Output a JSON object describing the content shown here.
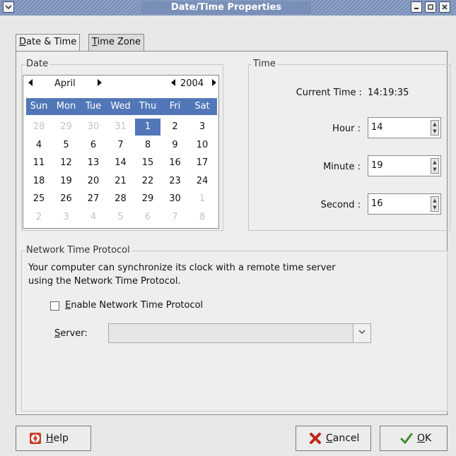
{
  "window": {
    "title": "Date/Time Properties",
    "menu_icon": "chevron-down-icon",
    "controls": [
      "minimize",
      "maximize",
      "close"
    ]
  },
  "tabs": [
    {
      "label_rest": "ate & Time",
      "accel": "D",
      "active": true
    },
    {
      "label_rest": "ime Zone",
      "accel": "T",
      "active": false
    }
  ],
  "date": {
    "frame_label": "Date",
    "month": "April",
    "year": "2004",
    "weekdays": [
      "Sun",
      "Mon",
      "Tue",
      "Wed",
      "Thu",
      "Fri",
      "Sat"
    ],
    "weeks": [
      [
        "28",
        "29",
        "30",
        "31",
        "1",
        "2",
        "3"
      ],
      [
        "4",
        "5",
        "6",
        "7",
        "8",
        "9",
        "10"
      ],
      [
        "11",
        "12",
        "13",
        "14",
        "15",
        "16",
        "17"
      ],
      [
        "18",
        "19",
        "20",
        "21",
        "22",
        "23",
        "24"
      ],
      [
        "25",
        "26",
        "27",
        "28",
        "29",
        "30",
        "1"
      ],
      [
        "2",
        "3",
        "4",
        "5",
        "6",
        "7",
        "8"
      ]
    ],
    "selected_day": "1"
  },
  "time": {
    "frame_label": "Time",
    "current_label": "Current Time :",
    "current_value": "14:19:35",
    "hour_label": "Hour :",
    "hour_value": "14",
    "minute_label": "Minute :",
    "minute_value": "19",
    "second_label": "Second :",
    "second_value": "16"
  },
  "ntp": {
    "frame_label": "Network Time Protocol",
    "line1": "Your computer can synchronize its clock with a remote time server",
    "line2": "using the Network Time Protocol.",
    "enable_accel": "E",
    "enable_rest": "nable Network Time Protocol",
    "enabled": false,
    "server_accel": "S",
    "server_rest": "erver:",
    "server_value": ""
  },
  "buttons": {
    "help_accel": "H",
    "help_rest": "elp",
    "cancel_accel": "C",
    "cancel_rest": "ancel",
    "ok_accel": "O",
    "ok_rest": "K"
  },
  "colors": {
    "accent": "#5277b8",
    "titlebar": "#7a8fb8"
  }
}
